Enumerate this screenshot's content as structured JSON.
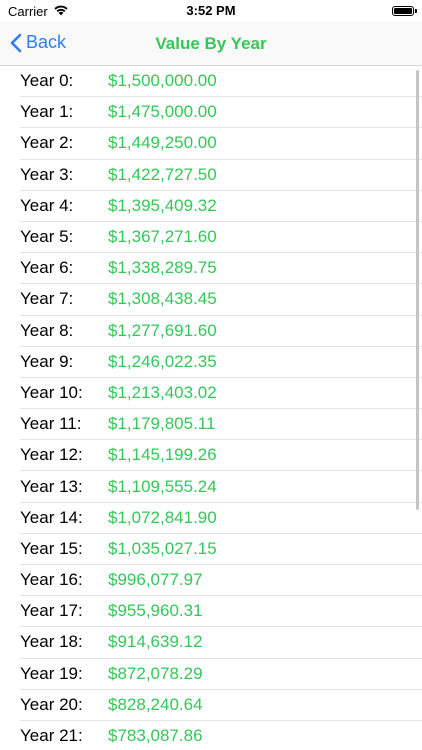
{
  "status_bar": {
    "carrier": "Carrier",
    "time": "3:52 PM",
    "battery_level": 1.0
  },
  "nav": {
    "back_label": "Back",
    "title": "Value By Year"
  },
  "colors": {
    "accent_blue": "#2f7cf6",
    "value_green": "#34c759"
  },
  "rows": [
    {
      "label": "Year 0:",
      "value": "$1,500,000.00"
    },
    {
      "label": "Year 1:",
      "value": "$1,475,000.00"
    },
    {
      "label": "Year 2:",
      "value": "$1,449,250.00"
    },
    {
      "label": "Year 3:",
      "value": "$1,422,727.50"
    },
    {
      "label": "Year 4:",
      "value": "$1,395,409.32"
    },
    {
      "label": "Year 5:",
      "value": "$1,367,271.60"
    },
    {
      "label": "Year 6:",
      "value": "$1,338,289.75"
    },
    {
      "label": "Year 7:",
      "value": "$1,308,438.45"
    },
    {
      "label": "Year 8:",
      "value": "$1,277,691.60"
    },
    {
      "label": "Year 9:",
      "value": "$1,246,022.35"
    },
    {
      "label": "Year 10:",
      "value": "$1,213,403.02"
    },
    {
      "label": "Year 11:",
      "value": "$1,179,805.11"
    },
    {
      "label": "Year 12:",
      "value": "$1,145,199.26"
    },
    {
      "label": "Year 13:",
      "value": "$1,109,555.24"
    },
    {
      "label": "Year 14:",
      "value": "$1,072,841.90"
    },
    {
      "label": "Year 15:",
      "value": "$1,035,027.15"
    },
    {
      "label": "Year 16:",
      "value": "$996,077.97"
    },
    {
      "label": "Year 17:",
      "value": "$955,960.31"
    },
    {
      "label": "Year 18:",
      "value": "$914,639.12"
    },
    {
      "label": "Year 19:",
      "value": "$872,078.29"
    },
    {
      "label": "Year 20:",
      "value": "$828,240.64"
    },
    {
      "label": "Year 21:",
      "value": "$783,087.86"
    }
  ]
}
